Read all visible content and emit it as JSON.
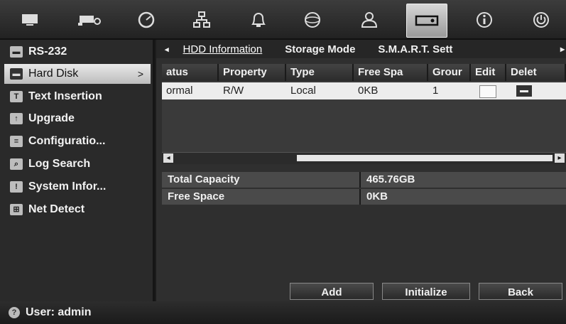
{
  "toolbar": {
    "icons": [
      {
        "name": "monitor-icon",
        "glyph": "▭"
      },
      {
        "name": "camera-icon",
        "glyph": "⌂"
      },
      {
        "name": "gauge-icon",
        "glyph": "◔"
      },
      {
        "name": "network-icon",
        "glyph": "⊞"
      },
      {
        "name": "alarm-bell-icon",
        "glyph": "🔔"
      },
      {
        "name": "globe-icon",
        "glyph": "◯"
      },
      {
        "name": "user-icon",
        "glyph": "☗"
      },
      {
        "name": "storage-icon",
        "glyph": "▭"
      },
      {
        "name": "info-icon",
        "glyph": "ⓘ"
      },
      {
        "name": "power-icon",
        "glyph": "⏻"
      }
    ]
  },
  "sidebar": {
    "items": [
      {
        "label": "RS-232",
        "icon": "▬"
      },
      {
        "label": "Hard Disk",
        "icon": "▬",
        "arrow": ">"
      },
      {
        "label": "Text Insertion",
        "icon": "T"
      },
      {
        "label": "Upgrade",
        "icon": "↑"
      },
      {
        "label": "Configuratio...",
        "icon": "≡"
      },
      {
        "label": "Log Search",
        "icon": "⌕"
      },
      {
        "label": "System Infor...",
        "icon": "!"
      },
      {
        "label": "Net Detect",
        "icon": "⊞"
      }
    ]
  },
  "tabs": {
    "left_arrow": "◂",
    "right_arrow": "▸",
    "items": [
      "HDD Information",
      "Storage Mode",
      "S.M.A.R.T. Sett"
    ]
  },
  "table": {
    "headers": [
      "atus",
      "Property",
      "Type",
      "Free Spa",
      "Grour",
      "Edit",
      "Delet"
    ],
    "rows": [
      {
        "status": "ormal",
        "property": "R/W",
        "type": "Local",
        "free": "0KB",
        "group": "1"
      }
    ]
  },
  "scroll": {
    "left": "◂",
    "right": "▸"
  },
  "info": {
    "total_capacity_label": "Total Capacity",
    "total_capacity_value": "465.76GB",
    "free_space_label": "Free Space",
    "free_space_value": "0KB"
  },
  "buttons": {
    "add": "Add",
    "initialize": "Initialize",
    "back": "Back"
  },
  "status": {
    "user": "User: admin"
  }
}
